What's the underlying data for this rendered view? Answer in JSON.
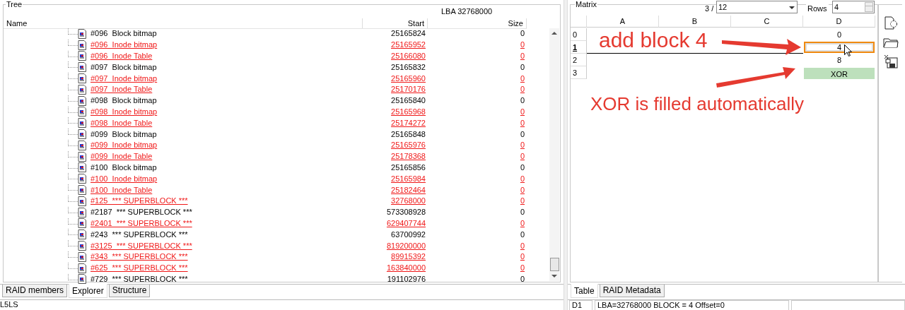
{
  "tree": {
    "title": "Tree",
    "lba": "LBA  32768000",
    "columns": [
      "Name",
      "Start",
      "Size"
    ],
    "rows": [
      {
        "name": "#096  Block bitmap",
        "start": "25165824",
        "size": "0",
        "marked": false
      },
      {
        "name": "#096  Inode bitmap",
        "start": "25165952",
        "size": "0",
        "marked": true
      },
      {
        "name": "#096  Inode Table",
        "start": "25166080",
        "size": "0",
        "marked": true
      },
      {
        "name": "#097  Block bitmap",
        "start": "25165832",
        "size": "0",
        "marked": false
      },
      {
        "name": "#097  Inode bitmap",
        "start": "25165960",
        "size": "0",
        "marked": true
      },
      {
        "name": "#097  Inode Table",
        "start": "25170176",
        "size": "0",
        "marked": true
      },
      {
        "name": "#098  Block bitmap",
        "start": "25165840",
        "size": "0",
        "marked": false
      },
      {
        "name": "#098  Inode bitmap",
        "start": "25165968",
        "size": "0",
        "marked": true
      },
      {
        "name": "#098  Inode Table",
        "start": "25174272",
        "size": "0",
        "marked": true
      },
      {
        "name": "#099  Block bitmap",
        "start": "25165848",
        "size": "0",
        "marked": false
      },
      {
        "name": "#099  Inode bitmap",
        "start": "25165976",
        "size": "0",
        "marked": true
      },
      {
        "name": "#099  Inode Table",
        "start": "25178368",
        "size": "0",
        "marked": true
      },
      {
        "name": "#100  Block bitmap",
        "start": "25165856",
        "size": "0",
        "marked": false
      },
      {
        "name": "#100  Inode bitmap",
        "start": "25165984",
        "size": "0",
        "marked": true
      },
      {
        "name": "#100  Inode Table",
        "start": "25182464",
        "size": "0",
        "marked": true
      },
      {
        "name": "#125  *** SUPERBLOCK ***",
        "start": "32768000",
        "size": "0",
        "marked": true
      },
      {
        "name": "#2187  *** SUPERBLOCK ***",
        "start": "573308928",
        "size": "0",
        "marked": false
      },
      {
        "name": "#2401  *** SUPERBLOCK ***",
        "start": "629407744",
        "size": "0",
        "marked": true
      },
      {
        "name": "#243  *** SUPERBLOCK ***",
        "start": "63700992",
        "size": "0",
        "marked": false
      },
      {
        "name": "#3125  *** SUPERBLOCK ***",
        "start": "819200000",
        "size": "0",
        "marked": true
      },
      {
        "name": "#343  *** SUPERBLOCK ***",
        "start": "89915392",
        "size": "0",
        "marked": true
      },
      {
        "name": "#625  *** SUPERBLOCK ***",
        "start": "163840000",
        "size": "0",
        "marked": true
      },
      {
        "name": "#729  *** SUPERBLOCK ***",
        "start": "191102976",
        "size": "0",
        "marked": false
      }
    ]
  },
  "left_tabs": [
    {
      "label": "RAID members",
      "selected": false
    },
    {
      "label": "Explorer",
      "selected": true
    },
    {
      "label": "Structure",
      "selected": false
    }
  ],
  "left_status": "L5LS",
  "matrix": {
    "title": "Matrix",
    "page_label": "3 /",
    "page": "12",
    "rows_label": "Rows",
    "rows_value": "4",
    "columns": [
      "A",
      "B",
      "C",
      "D"
    ],
    "rows": [
      {
        "label": "0",
        "selected": false,
        "cells": [
          null,
          null,
          null,
          {
            "text": "0",
            "kind": "plain"
          }
        ]
      },
      {
        "label": "1",
        "selected": true,
        "cells": [
          null,
          null,
          null,
          {
            "text": "4",
            "kind": "editing"
          }
        ]
      },
      {
        "label": "2",
        "selected": false,
        "cells": [
          null,
          null,
          null,
          {
            "text": "8",
            "kind": "plain"
          }
        ]
      },
      {
        "label": "3",
        "selected": false,
        "cells": [
          null,
          null,
          null,
          {
            "text": "XOR",
            "kind": "parity"
          }
        ]
      }
    ],
    "annotations": [
      "add block 4",
      "XOR is filled automatically"
    ]
  },
  "right_tabs": [
    {
      "label": "Table",
      "selected": true
    },
    {
      "label": "RAID Metadata",
      "selected": false
    }
  ],
  "right_status": {
    "cell": "D1",
    "info": "LBA=32768000 BLOCK = 4 Offset=0"
  }
}
